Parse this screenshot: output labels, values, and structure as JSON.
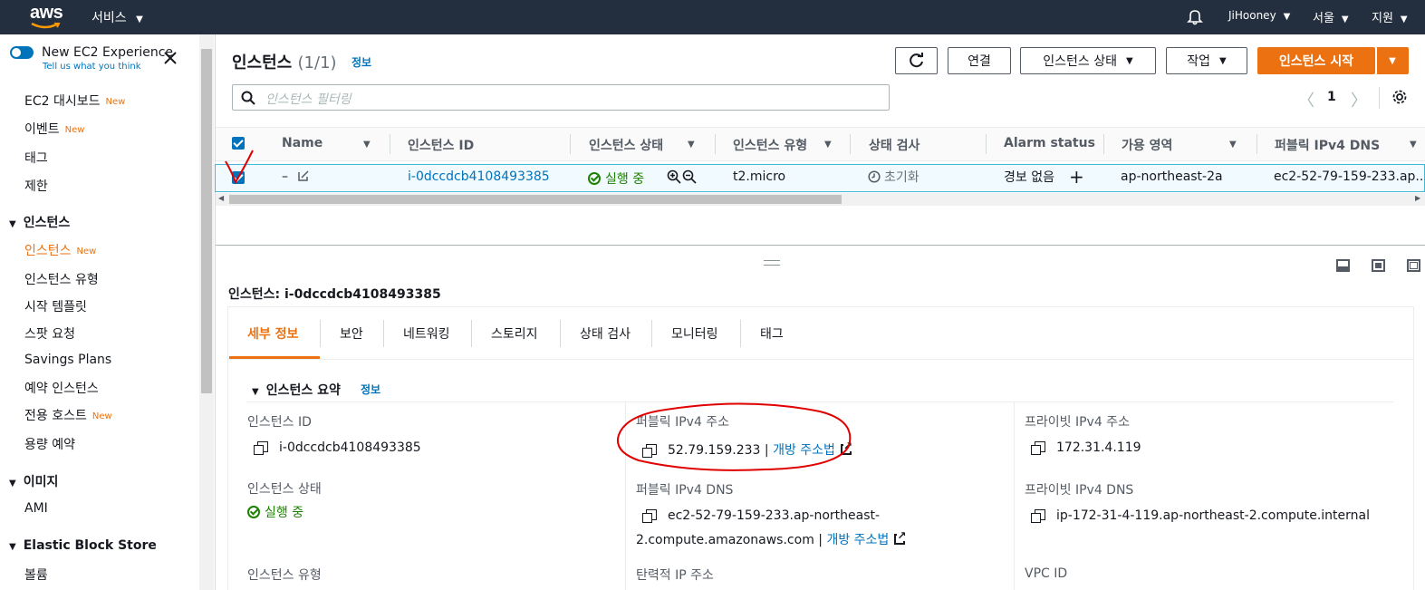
{
  "topbar": {
    "logo": "aws",
    "services_label": "서비스",
    "user": "JiHooney",
    "region": "서울",
    "support": "지원",
    "icons": [
      "bell-icon"
    ]
  },
  "sidebar": {
    "toggle_label": "New EC2 Experience",
    "feedback_link": "Tell us what you think",
    "items_top": [
      {
        "label": "EC2 대시보드",
        "badge": "New"
      },
      {
        "label": "이벤트",
        "badge": "New"
      },
      {
        "label": "태그",
        "badge": ""
      },
      {
        "label": "제한",
        "badge": ""
      }
    ],
    "section_instances": "인스턴스",
    "items_instances": [
      {
        "label": "인스턴스",
        "badge": "New"
      },
      {
        "label": "인스턴스 유형",
        "badge": ""
      },
      {
        "label": "시작 템플릿",
        "badge": ""
      },
      {
        "label": "스팟 요청",
        "badge": ""
      },
      {
        "label": "Savings Plans",
        "badge": ""
      },
      {
        "label": "예약 인스턴스",
        "badge": ""
      },
      {
        "label": "전용 호스트",
        "badge": "New"
      },
      {
        "label": "용량 예약",
        "badge": ""
      }
    ],
    "section_images": "이미지",
    "items_images": [
      {
        "label": "AMI",
        "badge": ""
      }
    ],
    "section_ebs": "Elastic Block Store",
    "items_ebs": [
      {
        "label": "볼륨",
        "badge": ""
      }
    ]
  },
  "header": {
    "title": "인스턴스",
    "count": "(1/1)",
    "info": "정보",
    "buttons": {
      "connect": "연결",
      "instance_state": "인스턴스 상태",
      "actions": "작업",
      "launch": "인스턴스 시작"
    },
    "search_placeholder": "인스턴스 필터링",
    "page": "1"
  },
  "table": {
    "columns": [
      "Name",
      "인스턴스 ID",
      "인스턴스 상태",
      "인스턴스 유형",
      "상태 검사",
      "Alarm status",
      "가용 영역",
      "퍼블릭 IPv4 DNS"
    ],
    "row": {
      "name": "–",
      "instance_id": "i-0dccdcb4108493385",
      "state": "실행 중",
      "type": "t2.micro",
      "status_check": "초기화",
      "alarm": "경보 없음",
      "az": "ap-northeast-2a",
      "public_dns": "ec2-52-79-159-233.ap..."
    }
  },
  "details": {
    "heading_prefix": "인스턴스:",
    "heading_id": "i-0dccdcb4108493385",
    "tabs": [
      "세부 정보",
      "보안",
      "네트워킹",
      "스토리지",
      "상태 검사",
      "모니터링",
      "태그"
    ],
    "summary_title": "인스턴스 요약",
    "summary_info": "정보",
    "fields": {
      "instance_id_label": "인스턴스 ID",
      "instance_id_value": "i-0dccdcb4108493385",
      "public_ipv4_label": "퍼블릭 IPv4 주소",
      "public_ipv4_value": "52.79.159.233",
      "open_address": "개방 주소법",
      "private_ipv4_label": "프라이빗 IPv4 주소",
      "private_ipv4_value": "172.31.4.119",
      "instance_state_label": "인스턴스 상태",
      "instance_state_value": "실행 중",
      "public_dns_label": "퍼블릭 IPv4 DNS",
      "public_dns_line1": "ec2-52-79-159-233.ap-northeast-",
      "public_dns_line2": "2.compute.amazonaws.com",
      "private_dns_label": "프라이빗 IPv4 DNS",
      "private_dns_value": "ip-172-31-4-119.ap-northeast-2.compute.internal",
      "instance_type_label": "인스턴스 유형",
      "elastic_ip_label": "탄력적 IP 주소",
      "vpc_id_label": "VPC ID"
    }
  },
  "colors": {
    "topbar": "#232f3e",
    "accent_orange": "#ec7211",
    "link_blue": "#0073bb",
    "running_green": "#1d8102",
    "annotation_red": "#e00000"
  }
}
